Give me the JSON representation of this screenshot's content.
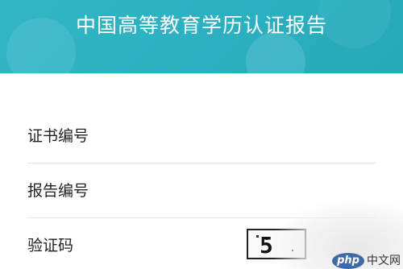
{
  "header": {
    "title": "中国高等教育学历认证报告",
    "color": "#2ab0c0"
  },
  "form": {
    "certificate_number_label": "证书编号",
    "report_number_label": "报告编号",
    "captcha_label": "验证码",
    "captcha_text": "5"
  },
  "watermark": {
    "logo": "php",
    "site": "中文网"
  }
}
